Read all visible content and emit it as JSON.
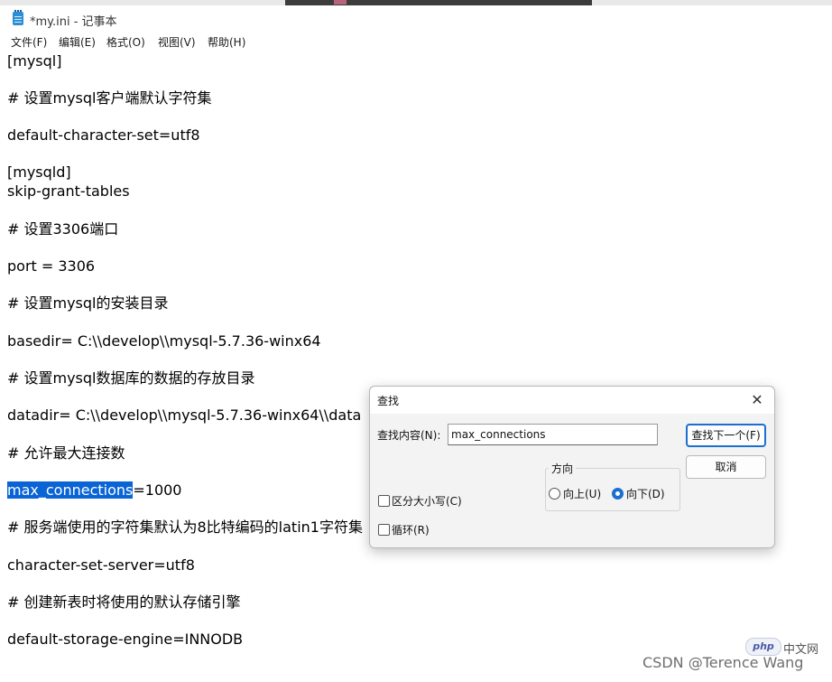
{
  "window": {
    "title": "*my.ini - 记事本",
    "menu": [
      "文件(F)",
      "编辑(E)",
      "格式(O)",
      "视图(V)",
      "帮助(H)"
    ]
  },
  "editor": {
    "lines": [
      "[mysql]",
      "# 设置mysql客户端默认字符集",
      "default-character-set=utf8",
      "[mysqld]",
      "skip-grant-tables",
      "# 设置3306端口",
      "port = 3306",
      "# 设置mysql的安装目录",
      "basedir= C:\\\\develop\\\\mysql-5.7.36-winx64",
      "# 设置mysql数据库的数据的存放目录",
      "datadir= C:\\\\develop\\\\mysql-5.7.36-winx64\\\\data",
      "# 允许最大连接数",
      "max_connections",
      "=1000",
      "# 服务端使用的字符集默认为8比特编码的latin1字符集",
      "character-set-server=utf8",
      "# 创建新表时将使用的默认存储引擎",
      "default-storage-engine=INNODB"
    ]
  },
  "find_dialog": {
    "title": "查找",
    "close_glyph": "✕",
    "find_label": "查找内容(N):",
    "find_value": "max_connections",
    "find_next": "查找下一个(F)",
    "cancel": "取消",
    "direction_label": "方向",
    "up_label": "向上(U)",
    "down_label": "向下(D)",
    "direction_selected": "down",
    "match_case": "区分大小写(C)",
    "wrap": "循环(R)"
  },
  "watermark": {
    "csdn": "CSDN @Terence Wang",
    "php_logo": "php",
    "php_cn": "中文网"
  },
  "colors": {
    "selection": "#0a64d6",
    "accent": "#1a6fd0"
  }
}
